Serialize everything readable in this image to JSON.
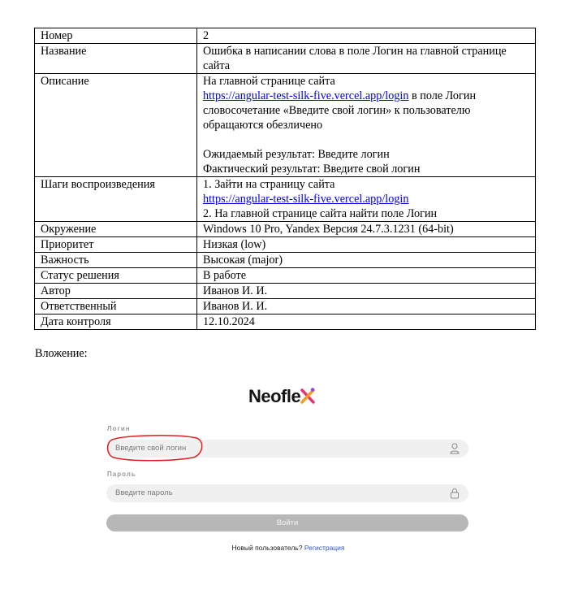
{
  "table": {
    "rows": [
      {
        "key": "Номер",
        "value": "2"
      },
      {
        "key": "Название",
        "value": "Ошибка в написании слова в поле Логин на главной странице сайта"
      },
      {
        "key": "Описание",
        "desc_intro": "На главной странице сайта",
        "desc_link": "https://angular-test-silk-five.vercel.app/login",
        "desc_rest": " в поле Логин словосочетание «Введите свой логин» к пользователю обращаются обезличено",
        "expected": "Ожидаемый результат: Введите логин",
        "actual": "Фактический результат: Введите свой логин"
      },
      {
        "key": "Шаги воспроизведения",
        "step1": "1. Зайти на страницу сайта",
        "step1_link": "https://angular-test-silk-five.vercel.app/login",
        "step2": "2.  На главной странице сайта найти поле Логин"
      },
      {
        "key": "Окружение",
        "value": "Windows 10 Pro, Yandex Версия 24.7.3.1231 (64-bit)"
      },
      {
        "key": "Приоритет",
        "value": "Низкая (low)"
      },
      {
        "key": "Важность",
        "value": "Высокая (major)"
      },
      {
        "key": "Статус решения",
        "value": "В работе"
      },
      {
        "key": "Автор",
        "value": "Иванов И. И."
      },
      {
        "key": "Ответственный",
        "value": "Иванов И. И."
      },
      {
        "key": "Дата контроля",
        "value": "12.10.2024"
      }
    ]
  },
  "attachment_label": "Вложение:",
  "screenshot": {
    "logo_text": "Neofle",
    "login_label": "Логин",
    "login_placeholder": "Введите свой логин",
    "password_label": "Пароль",
    "password_placeholder": "Введите пароль",
    "submit_label": "Войти",
    "new_user_text": "Новый пользователь?",
    "register_link": "Регистрация",
    "accent_colors": [
      "#e8336d",
      "#f59b23",
      "#8a3ff0"
    ],
    "annotation_color": "#e02020"
  }
}
